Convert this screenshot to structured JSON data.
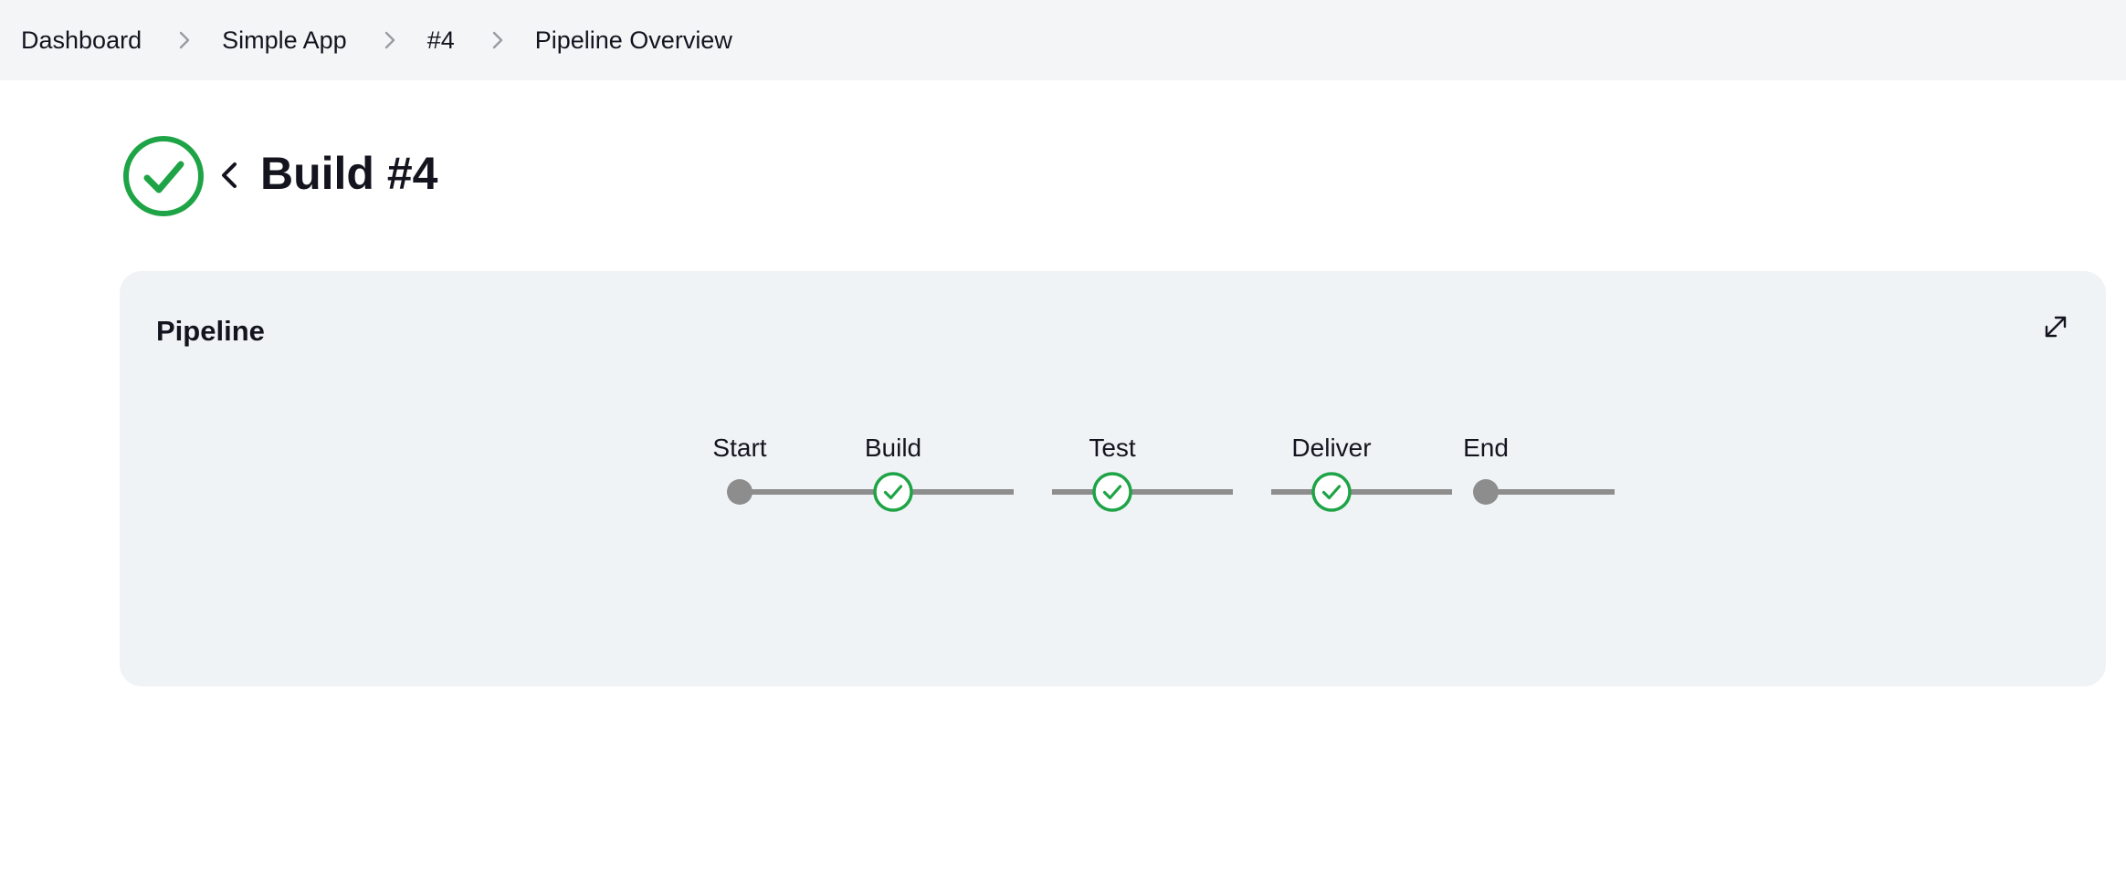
{
  "breadcrumb": {
    "items": [
      {
        "label": "Dashboard"
      },
      {
        "label": "Simple App"
      },
      {
        "label": "#4"
      },
      {
        "label": "Pipeline Overview"
      }
    ]
  },
  "header": {
    "status": "success",
    "status_icon": "check-circle-icon",
    "back_icon": "chevron-left-icon",
    "title": "Build #4"
  },
  "pipeline": {
    "title": "Pipeline",
    "expand_icon": "expand-icon",
    "start_label": "Start",
    "end_label": "End",
    "stages": [
      {
        "label": "Build",
        "status": "success"
      },
      {
        "label": "Test",
        "status": "success"
      },
      {
        "label": "Deliver",
        "status": "success"
      }
    ]
  },
  "colors": {
    "success": "#1ea446",
    "track": "#8d8d8d",
    "breadcrumb_bg": "#f4f5f7",
    "card_bg": "#f0f3f6"
  }
}
